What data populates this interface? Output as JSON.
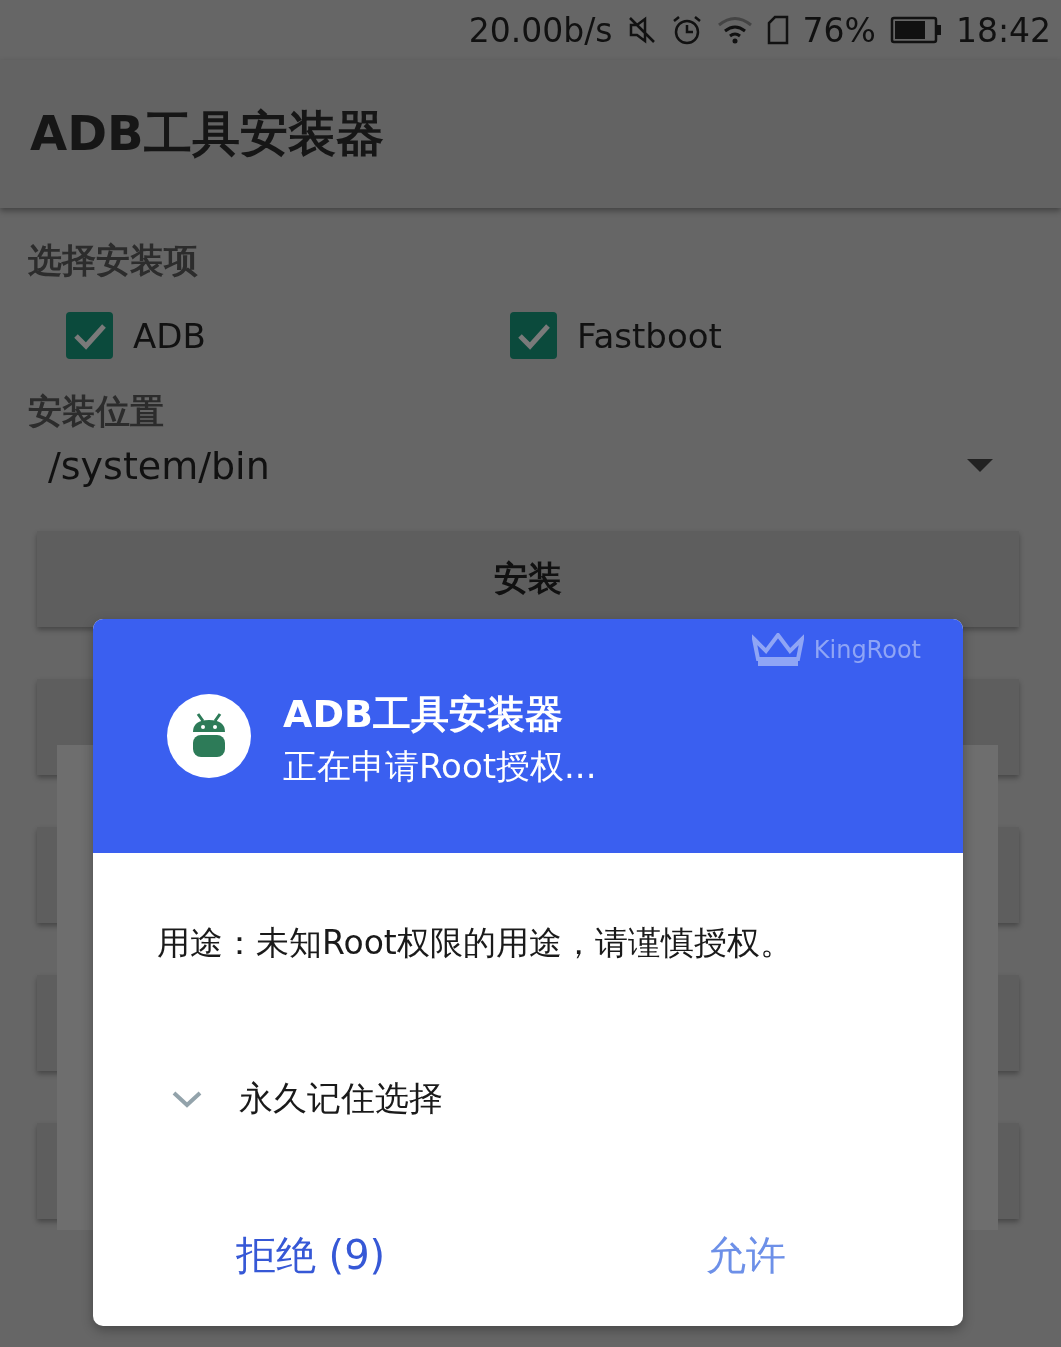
{
  "status_bar": {
    "net_speed": "20.00b/s",
    "battery_percent": "76%",
    "time": "18:42"
  },
  "app_bar": {
    "title": "ADB工具安装器"
  },
  "install_items": {
    "heading": "选择安装项",
    "options": [
      {
        "label": "ADB",
        "checked": true
      },
      {
        "label": "Fastboot",
        "checked": true
      }
    ]
  },
  "install_location": {
    "heading": "安装位置",
    "value": "/system/bin"
  },
  "install_button": "安装",
  "dialog": {
    "brand": "KingRoot",
    "app_name": "ADB工具安装器",
    "subtitle": "正在申请Root授权...",
    "purpose": "用途：未知Root权限的用途，请谨慎授权。",
    "remember": {
      "label": "永久记住选择",
      "expanded": false
    },
    "buttons": [
      {
        "label": "拒绝 (9)",
        "kind": "deny"
      },
      {
        "label": "允许",
        "kind": "allow"
      }
    ]
  }
}
